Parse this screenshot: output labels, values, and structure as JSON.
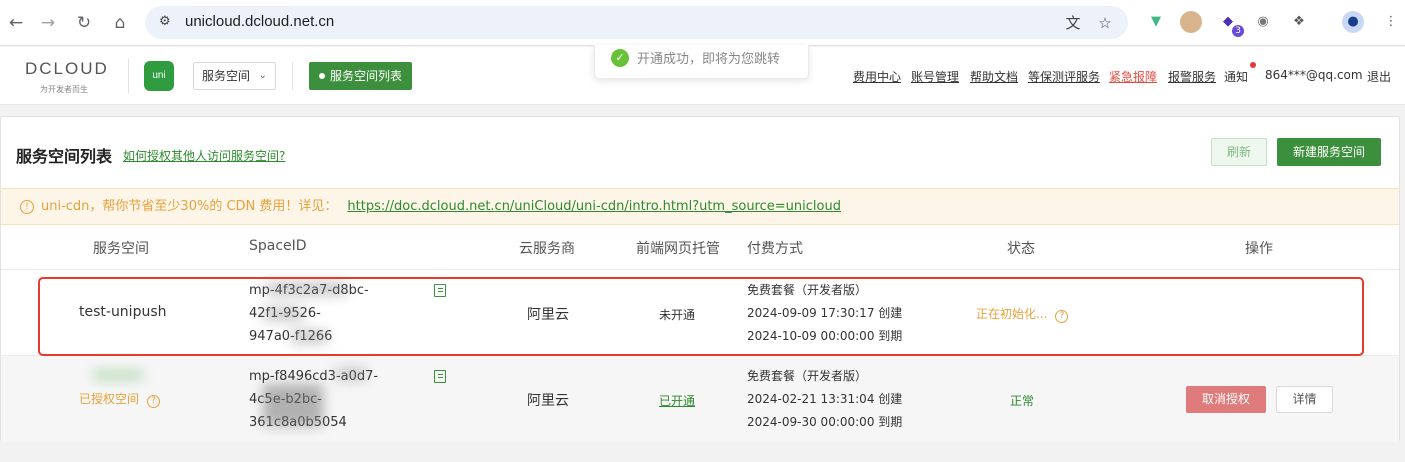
{
  "browser": {
    "url": "unicloud.dcloud.net.cn",
    "extension_badge": "3"
  },
  "header": {
    "logo_text": "DCLOUD",
    "logo_tagline": "为开发者而生",
    "uni_logo_text": "uni",
    "space_select": "服务空间",
    "active_nav": "服务空间列表",
    "toast": "开通成功，即将为您跳转",
    "links": [
      "费用中心",
      "账号管理",
      "帮助文档",
      "等保测评服务",
      "紧急报障",
      "报警服务"
    ],
    "notify": "通知",
    "account": "864***@qq.com",
    "logout": "退出"
  },
  "panel": {
    "title": "服务空间列表",
    "help_link": "如何授权其他人访问服务空间?",
    "refresh": "刷新",
    "create": "新建服务空间",
    "notice_text": "uni-cdn，帮你节省至少30%的 CDN 费用！详见：",
    "notice_link": "https://doc.dcloud.net.cn/uniCloud/uni-cdn/intro.html?utm_source=unicloud"
  },
  "table": {
    "columns": [
      "服务空间",
      "SpaceID",
      "云服务商",
      "前端网页托管",
      "付费方式",
      "状态",
      "操作"
    ],
    "rows": [
      {
        "name": "test-unipush",
        "space_id": [
          "mp-4f3c2a7-d8bc-",
          "42f1-9526-",
          "947a0-f1266"
        ],
        "provider": "阿里云",
        "hosting": "未开通",
        "plan": "免费套餐（开发者版）",
        "created": "2024-09-09 17:30:17 创建",
        "expires": "2024-10-09 00:00:00 到期",
        "status": "正在初始化..."
      },
      {
        "name": "已授权空间",
        "space_id": [
          "mp-f8496cd3-a0d7-",
          "4c5e-b2bc-",
          "361c8a0b5054"
        ],
        "provider": "阿里云",
        "hosting": "已开通",
        "plan": "免费套餐（开发者版）",
        "created": "2024-02-21 13:31:04 创建",
        "expires": "2024-09-30 00:00:00 到期",
        "status": "正常",
        "action_cancel": "取消授权",
        "action_detail": "详情"
      }
    ]
  }
}
